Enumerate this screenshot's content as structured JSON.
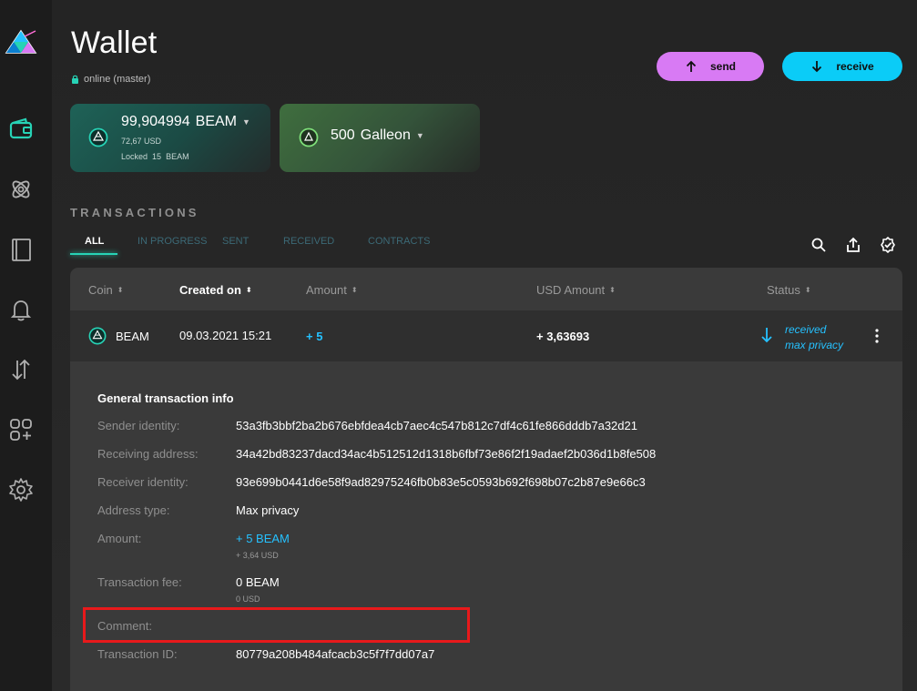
{
  "sidebar": {
    "logo": "beam-logo",
    "items": [
      {
        "name": "wallet",
        "icon": "wallet-icon"
      },
      {
        "name": "atomic-swap",
        "icon": "atom-icon"
      },
      {
        "name": "address-book",
        "icon": "book-icon"
      },
      {
        "name": "notifications",
        "icon": "bell-icon"
      },
      {
        "name": "utxo",
        "icon": "arrows-icon"
      },
      {
        "name": "applications",
        "icon": "apps-icon"
      },
      {
        "name": "settings",
        "icon": "gear-icon"
      }
    ]
  },
  "header": {
    "title": "Wallet",
    "status": "online (master)",
    "send_label": "send",
    "receive_label": "receive"
  },
  "assets": [
    {
      "amount": "99,904994",
      "unit": "BEAM",
      "usd": "72,67 USD",
      "locked_label": "Locked",
      "locked_amount": "15",
      "locked_unit": "BEAM"
    },
    {
      "amount": "500",
      "unit": "Galleon"
    }
  ],
  "transactions": {
    "section_title": "TRANSACTIONS",
    "tabs": [
      "ALL",
      "IN PROGRESS",
      "SENT",
      "RECEIVED",
      "CONTRACTS"
    ],
    "active_tab": "ALL",
    "columns": [
      "Coin",
      "Created on",
      "Amount",
      "USD Amount",
      "Status"
    ],
    "sorted_column": "Created on",
    "row": {
      "coin": "BEAM",
      "created_on": "09.03.2021 15:21",
      "amount": "+ 5",
      "usd_amount": "+ 3,63693",
      "status_line1": "received",
      "status_line2": "max privacy"
    }
  },
  "details": {
    "title": "General transaction info",
    "sender_identity_label": "Sender identity:",
    "sender_identity": "53a3fb3bbf2ba2b676ebfdea4cb7aec4c547b812c7df4c61fe866dddb7a32d21",
    "receiving_address_label": "Receiving address:",
    "receiving_address": "34a42bd83237dacd34ac4b512512d1318b6fbf73e86f2f19adaef2b036d1b8fe508",
    "receiver_identity_label": "Receiver identity:",
    "receiver_identity": "93e699b0441d6e58f9ad82975246fb0b83e5c0593b692f698b07c2b87e9e66c3",
    "address_type_label": "Address type:",
    "address_type": "Max privacy",
    "amount_label": "Amount:",
    "amount": "+ 5  BEAM",
    "amount_usd": "+ 3,64 USD",
    "fee_label": "Transaction fee:",
    "fee": "0  BEAM",
    "fee_usd": "0 USD",
    "comment_label": "Comment:",
    "tx_id_label": "Transaction ID:",
    "tx_id": "80779a208b484afcacb3c5f7f7dd07a7"
  },
  "colors": {
    "accent_green": "#27d3b6",
    "send": "#d87af4",
    "receive": "#0bccf7",
    "blue_text": "#25c1ff",
    "highlight": "#e8191b"
  }
}
